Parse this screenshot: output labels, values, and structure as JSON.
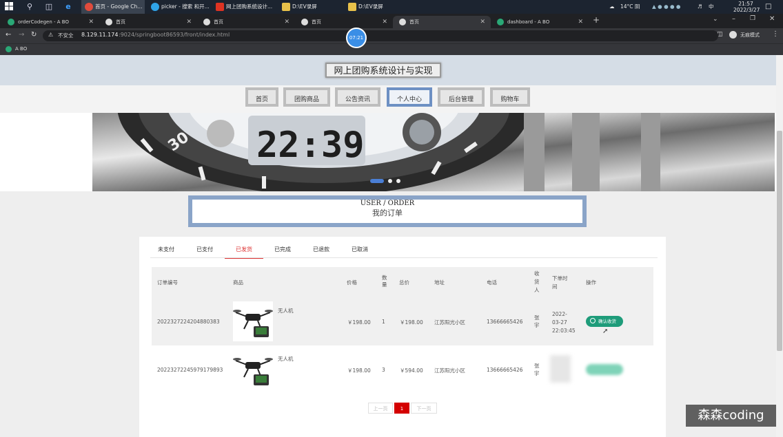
{
  "taskbar": {
    "apps": [
      {
        "label": "首页 - Google Ch...",
        "color": "#e04b3c",
        "active": true
      },
      {
        "label": "picker - 搜索 和开...",
        "color": "#2fa4e7"
      },
      {
        "label": "网上团购系统设计...",
        "color": "#d32"
      },
      {
        "label": "D:\\EV录屏",
        "color": "#e8c14a"
      },
      {
        "label": "D:\\EV录屏",
        "color": "#e8c14a"
      }
    ],
    "weather": "14°C 阴",
    "ime": "中",
    "time": "21:57",
    "date": "2022/3/27"
  },
  "browser": {
    "tabs": [
      {
        "label": "orderCodegen - A BO",
        "fav": "#2aa876"
      },
      {
        "label": "首页",
        "fav": "#ddd"
      },
      {
        "label": "首页",
        "fav": "#ddd"
      },
      {
        "label": "首页",
        "fav": "#ddd"
      },
      {
        "label": "首页",
        "fav": "#ddd",
        "active": true
      },
      {
        "label": "dashboard - A BO",
        "fav": "#2aa876"
      }
    ],
    "new_tab": "+",
    "security_label": "不安全",
    "url_host": "8.129.11.174",
    "url_path": ":9024/springboot86593/front/index.html",
    "profile_label": "无痕模式",
    "bookmark": "A BO",
    "timer_badge": "07:21"
  },
  "site": {
    "title": "网上团购系统设计与实现",
    "nav": [
      {
        "label": "首页"
      },
      {
        "label": "团购商品"
      },
      {
        "label": "公告资讯"
      },
      {
        "label": "个人中心",
        "active": true
      },
      {
        "label": "后台管理"
      },
      {
        "label": "购物车"
      }
    ],
    "banner_clock_text": "22:39",
    "banner_bezel_number": "30"
  },
  "user_section": {
    "title_en": "USER / ORDER",
    "title_cn": "我的订单"
  },
  "order_tabs": [
    {
      "label": "未支付"
    },
    {
      "label": "已支付"
    },
    {
      "label": "已发货",
      "active": true
    },
    {
      "label": "已完成"
    },
    {
      "label": "已退款"
    },
    {
      "label": "已取消"
    }
  ],
  "table": {
    "headers": {
      "order_no": "订单编号",
      "product": "商品",
      "price": "价格",
      "qty": [
        "数",
        "量"
      ],
      "total": "总价",
      "address": "地址",
      "phone": "电话",
      "receiver": [
        "收",
        "货",
        "人"
      ],
      "time": [
        "下单时",
        "间"
      ],
      "action": "操作"
    },
    "rows": [
      {
        "order_no": "2022327224204880383",
        "product_name": "无人机",
        "price": "￥198.00",
        "qty": "1",
        "total": "￥198.00",
        "address": "江苏阳光小区",
        "phone": "13666665426",
        "receiver": [
          "张",
          "宇"
        ],
        "time": [
          "2022-",
          "03-27",
          "22:03:45"
        ],
        "action": "确认收货"
      },
      {
        "order_no": "2022327224597917989­3",
        "product_name": "无人机",
        "price": "￥198.00",
        "qty": "3",
        "total": "￥594.00",
        "address": "江苏阳光小区",
        "phone": "13666665426",
        "receiver": [
          "张",
          "宇"
        ],
        "time": [
          "",
          "",
          ""
        ],
        "action": ""
      }
    ]
  },
  "pagination": {
    "prev": "上一页",
    "current": "1",
    "next": "下一页"
  },
  "watermark": "森森coding"
}
